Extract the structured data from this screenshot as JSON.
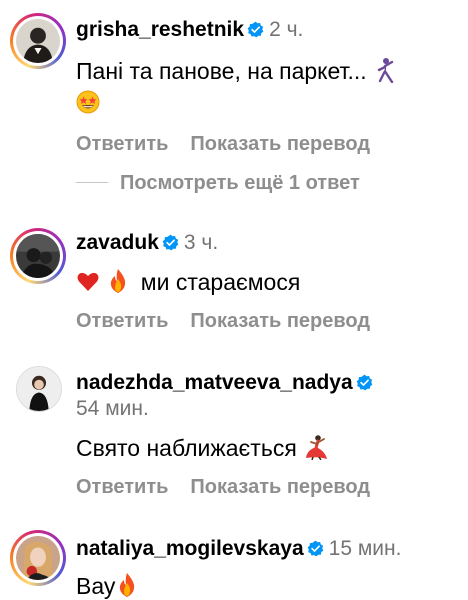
{
  "comments": [
    {
      "username": "grisha_reshetnik",
      "verified": true,
      "time": "2 ч.",
      "text": "Пані та панове, на паркет...",
      "emojis": [
        "dancer-emoji",
        "star-struck-emoji"
      ],
      "reply_label": "Ответить",
      "translate_label": "Показать перевод",
      "avatar_story_ring": true
    },
    {
      "username": "zavaduk",
      "verified": true,
      "time": "3 ч.",
      "text": "ми стараємося",
      "emojis": [
        "red-heart-emoji",
        "fire-emoji"
      ],
      "reply_label": "Ответить",
      "translate_label": "Показать перевод",
      "avatar_story_ring": true
    },
    {
      "username": "nadezhda_matveeva_nadya",
      "verified": true,
      "time": "54 мин.",
      "text": "Свято наближається",
      "emojis": [
        "flamenco-dancer-emoji"
      ],
      "reply_label": "Ответить",
      "translate_label": "Показать перевод",
      "avatar_story_ring": false
    },
    {
      "username": "nataliya_mogilevskaya",
      "verified": true,
      "time": "15 мин.",
      "text": "Вау",
      "emojis": [
        "fire-emoji"
      ],
      "avatar_story_ring": true
    }
  ],
  "view_replies": "Посмотреть ещё 1 ответ",
  "colors": {
    "verified_badge": "#0095f6",
    "secondary_text": "#737373",
    "action_text": "#8e8e8e"
  }
}
